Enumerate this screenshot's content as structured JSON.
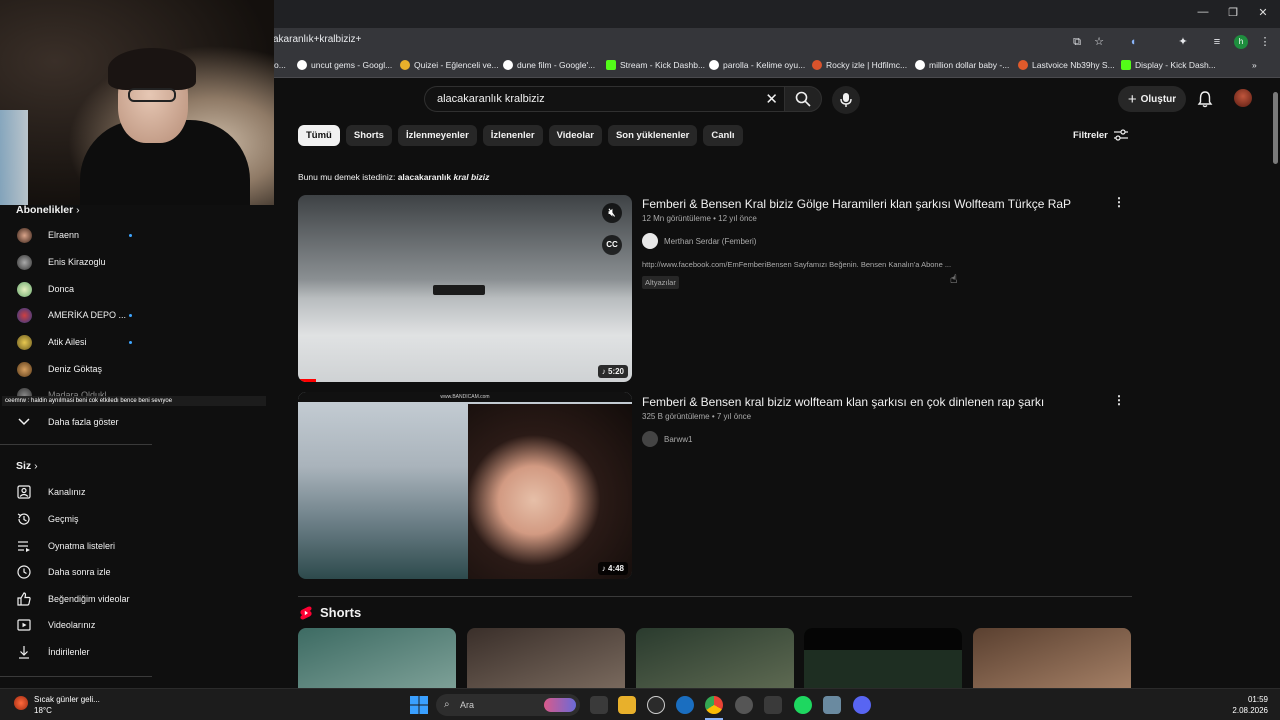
{
  "browser": {
    "url": "cakaranlık+kralbiziz+",
    "profile_initial": "h",
    "bookmarks": [
      {
        "label": "o..."
      },
      {
        "label": "uncut gems - Googl..."
      },
      {
        "label": "Quizei - Eğlenceli ve..."
      },
      {
        "label": "dune film - Google'..."
      },
      {
        "label": "Stream - Kick Dashb..."
      },
      {
        "label": "parolla - Kelime oyu..."
      },
      {
        "label": "Rocky izle | Hdfilmc..."
      },
      {
        "label": "million dollar baby -..."
      },
      {
        "label": "Lastvoice Nb39hy S..."
      },
      {
        "label": "Display - Kick Dash..."
      }
    ],
    "more_bookmarks": "»"
  },
  "header": {
    "search_value": "alacakaranlık kralbiziz",
    "create_label": "Oluştur"
  },
  "chips": [
    "Tümü",
    "Shorts",
    "İzlenmeyenler",
    "İzlenenler",
    "Videolar",
    "Son yüklenenler",
    "Canlı"
  ],
  "filters_label": "Filtreler",
  "suggestion": {
    "prefix": "Bunu mu demek istediniz:",
    "plain": "alacakaranlık",
    "italic": "kral biziz"
  },
  "videos": [
    {
      "title": "Femberi & Bensen Kral biziz Gölge Haramileri klan şarkısı Wolfteam Türkçe RaP",
      "meta": "12 Mn görüntüleme • 12 yıl önce",
      "channel": "Merthan Serdar (Femberi)",
      "description": "http://www.facebook.com/EmFemberiBensen Sayfamızı Beğenin. Bensen Kanalın'a Abone ...",
      "badge": "Altyazılar",
      "duration": "♪ 5:20",
      "cc": "CC"
    },
    {
      "title": "Femberi & Bensen kral biziz wolfteam klan şarkısı en çok dinlenen rap şarkı",
      "meta": "325 B görüntüleme • 7 yıl önce",
      "channel": "Barww1",
      "duration": "♪ 4:48",
      "watermark": "www.BANDICAM.com"
    }
  ],
  "shorts_label": "Shorts",
  "sidebar": {
    "subscriptions_head": "Abonelikler",
    "subscriptions": [
      {
        "name": "Elraenn",
        "live": true
      },
      {
        "name": "Enis Kirazoglu",
        "live": false
      },
      {
        "name": "Donca",
        "live": false
      },
      {
        "name": "AMERİKA DEPO ...",
        "live": true
      },
      {
        "name": "Atik Ailesi",
        "live": true
      },
      {
        "name": "Deniz Göktaş",
        "live": false
      },
      {
        "name": "Madara Oldukl",
        "live": false
      }
    ],
    "show_more": "Daha fazla göster",
    "you_head": "Siz",
    "you_items": [
      {
        "label": "Kanalınız"
      },
      {
        "label": "Geçmiş"
      },
      {
        "label": "Oynatma listeleri"
      },
      {
        "label": "Daha sonra izle"
      },
      {
        "label": "Beğendiğim videolar"
      },
      {
        "label": "Videolarınız"
      },
      {
        "label": "İndirilenler"
      }
    ]
  },
  "chat_overlay": "ceemrw : haldin aynılmasi beni cok etkiledı bence beni sevıyoe",
  "taskbar": {
    "search_label": "Ara",
    "weather_text": "Sıcak günler geli...",
    "weather_temp": "18°C",
    "time": "01:59",
    "date": "2.08.2026"
  }
}
